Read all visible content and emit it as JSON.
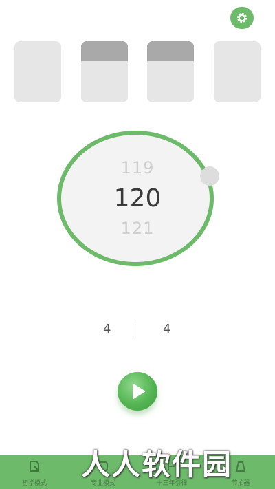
{
  "header": {
    "settings_icon": "gear-icon"
  },
  "beats": [
    {
      "accent_level": 0
    },
    {
      "accent_level": 0.33
    },
    {
      "accent_level": 0.33
    },
    {
      "accent_level": 0
    }
  ],
  "tempo": {
    "previous": "119",
    "current": "120",
    "next": "121"
  },
  "time_signature": {
    "beats_per_bar": "4",
    "note_value": "4"
  },
  "controls": {
    "play_icon": "play-icon"
  },
  "tabs": [
    {
      "label": "初学模式",
      "icon": "beginner-icon"
    },
    {
      "label": "专业模式",
      "icon": "pro-icon"
    },
    {
      "label": "十三年引律",
      "icon": "rhythm-icon"
    },
    {
      "label": "节拍器",
      "icon": "metronome-icon"
    }
  ],
  "watermark": {
    "text": "人人软件园"
  },
  "colors": {
    "accent": "#6dba6b",
    "beat_bg": "#e6e6e6",
    "beat_fill": "#a9a9a9"
  }
}
